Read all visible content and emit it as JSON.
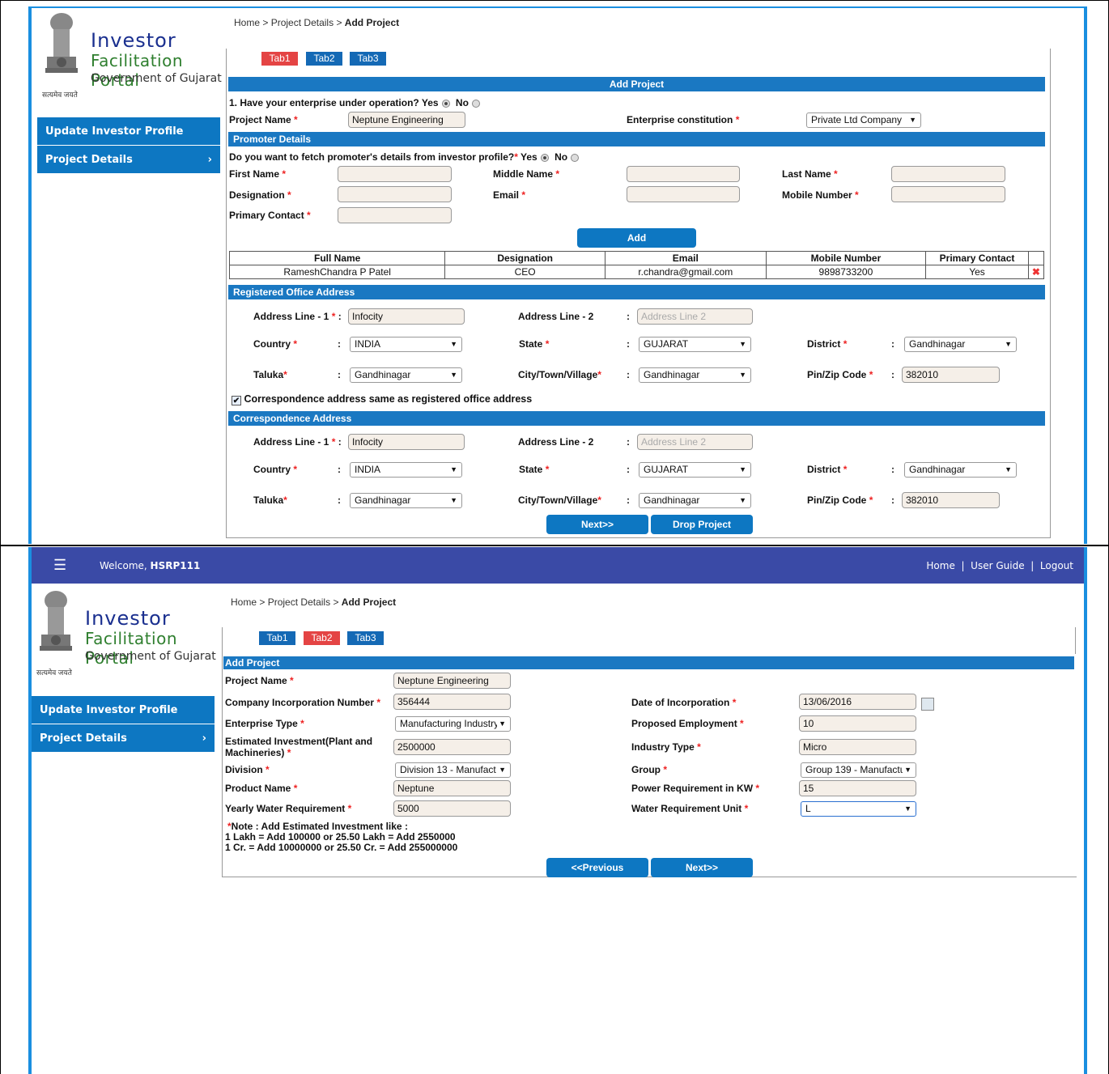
{
  "brand": {
    "line1": "Investor",
    "line2": "Facilitation Portal",
    "line3": "Government of Gujarat",
    "motto": "सत्यमेव जयते"
  },
  "sidebar": {
    "items": [
      {
        "label": "Update Investor Profile"
      },
      {
        "label": "Project Details",
        "chevron": "›"
      }
    ]
  },
  "top": {
    "breadcrumb": {
      "home": "Home",
      "sep": ">",
      "project_details": "Project Details",
      "current": "Add Project"
    },
    "tabs": [
      {
        "label": "Tab1",
        "state": "active"
      },
      {
        "label": "Tab2"
      },
      {
        "label": "Tab3"
      }
    ],
    "header": "Add Project",
    "q_operation": "1. Have your enterprise under operation?",
    "yes": "Yes",
    "no": "No",
    "project_name_label": "Project Name",
    "project_name": "Neptune Engineering",
    "constitution_label": "Enterprise constitution",
    "constitution": "Private Ltd Company",
    "promoter_header": "Promoter Details",
    "q_fetch": "Do you want to fetch promoter's details from investor profile?",
    "first_name": "First Name",
    "middle_name": "Middle Name",
    "last_name": "Last Name",
    "designation": "Designation",
    "email": "Email",
    "mobile": "Mobile Number",
    "primary_contact": "Primary Contact",
    "add_button": "Add",
    "promoter_table": {
      "columns": [
        "Full Name",
        "Designation",
        "Email",
        "Mobile Number",
        "Primary Contact"
      ],
      "rows": [
        [
          "RameshChandra P Patel",
          "CEO",
          "r.chandra@gmail.com",
          "9898733200",
          "Yes"
        ]
      ]
    },
    "reg_header": "Registered Office Address",
    "corr_header": "Correspondence Address",
    "addr1_label": "Address Line - 1",
    "addr2_label": "Address Line - 2",
    "addr1": "Infocity",
    "addr2_placeholder": "Address Line 2",
    "country_label": "Country",
    "country": "INDIA",
    "state_label": "State",
    "state": "GUJARAT",
    "district_label": "District",
    "district": "Gandhinagar",
    "taluka_label": "Taluka",
    "taluka": "Gandhinagar",
    "city_label": "City/Town/Village",
    "city": "Gandhinagar",
    "pin_label": "Pin/Zip Code",
    "pin": "382010",
    "colon": ":",
    "same_address": "Correspondence address same as registered office address",
    "next_button": "Next>>",
    "drop_button": "Drop Project"
  },
  "bottom": {
    "welcome": "Welcome,",
    "user": "HSRP111",
    "nav": {
      "home": "Home",
      "sep": "|",
      "guide": "User Guide",
      "logout": "Logout"
    },
    "breadcrumb": {
      "home": "Home",
      "sep": ">",
      "project_details": "Project Details",
      "current": "Add Project"
    },
    "tabs": [
      {
        "label": "Tab1"
      },
      {
        "label": "Tab2",
        "state": "active"
      },
      {
        "label": "Tab3"
      }
    ],
    "header": "Add Project",
    "fields": {
      "project_name_label": "Project Name",
      "project_name": "Neptune Engineering",
      "cin_label": "Company Incorporation Number",
      "cin": "356444",
      "doi_label": "Date of Incorporation",
      "doi": "13/06/2016",
      "ent_type_label": "Enterprise Type",
      "ent_type": "Manufacturing Industry",
      "employment_label": "Proposed Employment",
      "employment": "10",
      "investment_label1": "Estimated Investment(Plant and",
      "investment_label2": "Machineries)",
      "investment": "2500000",
      "industry_type_label": "Industry Type",
      "industry_type": "Micro",
      "division_label": "Division",
      "division": "Division 13 - Manufact",
      "group_label": "Group",
      "group": "Group 139 - Manufactu",
      "product_label": "Product Name",
      "product": "Neptune",
      "power_label": "Power Requirement in KW",
      "power": "15",
      "water_label": "Yearly Water Requirement",
      "water": "5000",
      "water_unit_label": "Water Requirement Unit",
      "water_unit": "L"
    },
    "note1": "Note : Add Estimated Investment like :",
    "note2": "1 Lakh = Add 100000 or 25.50 Lakh = Add 2550000",
    "note3": "1 Cr. = Add 10000000 or 25.50 Cr. = Add 255000000",
    "prev_button": "<<Previous",
    "next_button": "Next>>"
  },
  "colors": {
    "primary": "#0d77c2",
    "active_tab": "#e44444",
    "topbar": "#3a4aa6",
    "accent_border": "#1a8fe0"
  }
}
